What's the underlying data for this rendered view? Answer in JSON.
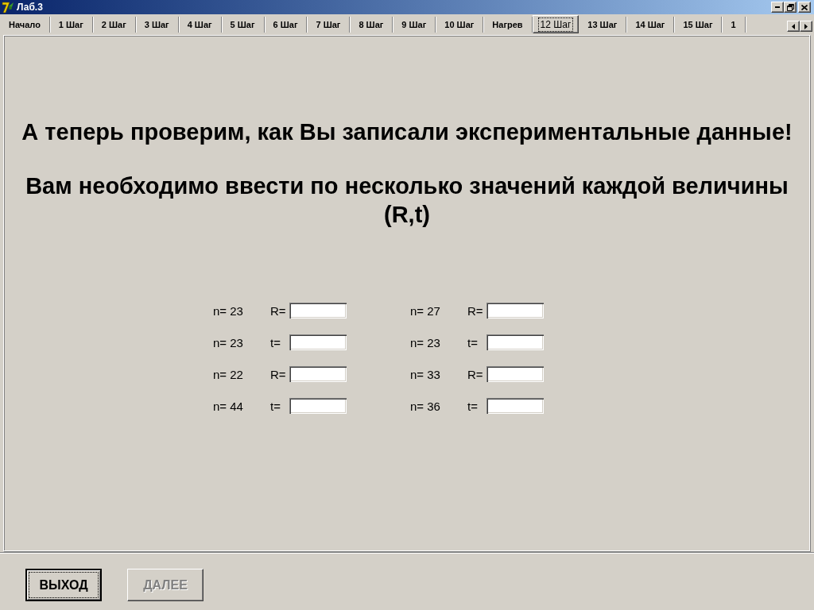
{
  "window": {
    "title": "Лаб.3"
  },
  "tabs": [
    {
      "label": "Начало",
      "selected": false
    },
    {
      "label": "1 Шаг",
      "selected": false
    },
    {
      "label": "2 Шаг",
      "selected": false
    },
    {
      "label": "3 Шаг",
      "selected": false
    },
    {
      "label": "4 Шаг",
      "selected": false
    },
    {
      "label": "5 Шаг",
      "selected": false
    },
    {
      "label": "6 Шаг",
      "selected": false
    },
    {
      "label": "7 Шаг",
      "selected": false
    },
    {
      "label": "8 Шаг",
      "selected": false
    },
    {
      "label": "9 Шаг",
      "selected": false
    },
    {
      "label": "10 Шаг",
      "selected": false
    },
    {
      "label": "Нагрев",
      "selected": false
    },
    {
      "label": "12 Шаг",
      "selected": true
    },
    {
      "label": "13 Шаг",
      "selected": false
    },
    {
      "label": "14 Шаг",
      "selected": false
    },
    {
      "label": "15 Шаг",
      "selected": false
    },
    {
      "label": "1",
      "selected": false
    }
  ],
  "heading": "А теперь проверим, как Вы записали экспериментальные данные!",
  "instruction": "Вам необходимо ввести по несколько значений каждой величины (R,t)",
  "fields": [
    {
      "n": "n= 23",
      "label": "R="
    },
    {
      "n": "n= 27",
      "label": "R="
    },
    {
      "n": "n= 23",
      "label": "t="
    },
    {
      "n": "n= 23",
      "label": "t="
    },
    {
      "n": "n= 22",
      "label": "R="
    },
    {
      "n": "n= 33",
      "label": "R="
    },
    {
      "n": "n= 44",
      "label": "t="
    },
    {
      "n": "n= 36",
      "label": "t="
    }
  ],
  "buttons": [
    {
      "label": "ВЫХОД",
      "disabled": false,
      "focused": true
    },
    {
      "label": "ДАЛЕЕ",
      "disabled": true,
      "focused": false
    }
  ]
}
